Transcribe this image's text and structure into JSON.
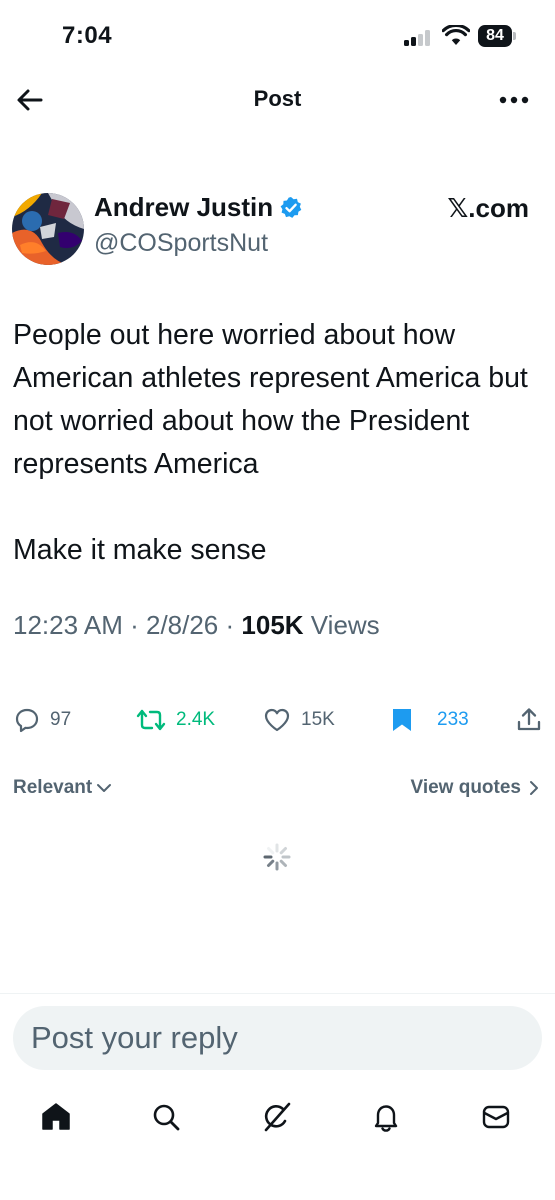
{
  "status_bar": {
    "time": "7:04",
    "battery": "84"
  },
  "header": {
    "title": "Post"
  },
  "author": {
    "name": "Andrew Justin",
    "handle": "@COSportsNut",
    "source": "𝕏.com"
  },
  "tweet": {
    "text": "People out here worried about how American athletes represent America but not worried about how the President represents America\n\nMake it make sense",
    "time": "12:23 AM",
    "date": "2/8/26",
    "views_count": "105K",
    "views_label": "Views"
  },
  "actions": {
    "replies": "97",
    "reposts": "2.4K",
    "likes": "15K",
    "bookmarks": "233"
  },
  "colors": {
    "repost": "#00ba7c",
    "bookmark": "#1d9bf0",
    "secondary_text": "#536471",
    "verified": "#1d9bf0"
  },
  "filters": {
    "sort": "Relevant",
    "quotes": "View quotes"
  },
  "reply": {
    "placeholder": "Post your reply"
  },
  "tabs": [
    "home-icon",
    "search-icon",
    "grok-icon",
    "notifications-icon",
    "messages-icon"
  ]
}
